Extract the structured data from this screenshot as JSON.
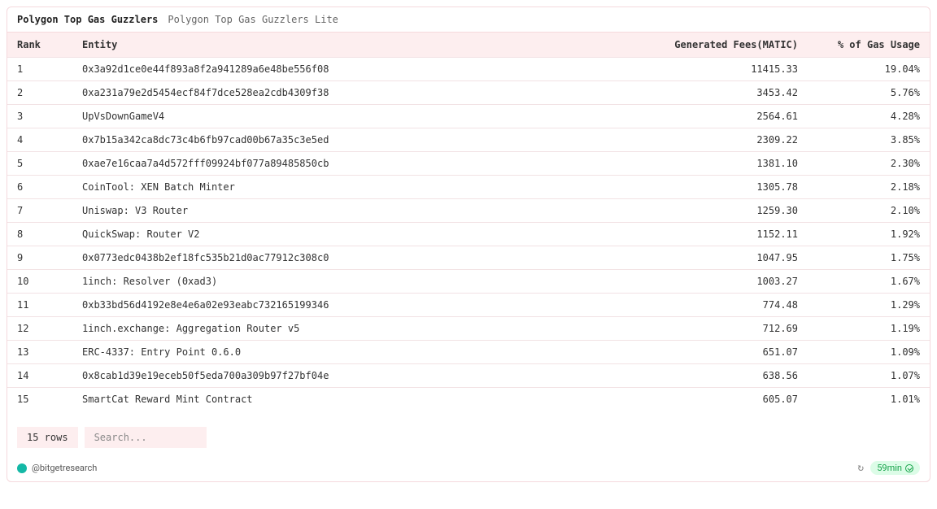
{
  "tabs": {
    "active": "Polygon Top Gas Guzzlers",
    "inactive": "Polygon Top Gas Guzzlers Lite"
  },
  "columns": {
    "rank": "Rank",
    "entity": "Entity",
    "fees": "Generated Fees(MATIC)",
    "pct": "% of Gas Usage"
  },
  "rows": [
    {
      "rank": "1",
      "entity": "0x3a92d1ce0e44f893a8f2a941289a6e48be556f08",
      "fees": "11415.33",
      "pct": "19.04%"
    },
    {
      "rank": "2",
      "entity": "0xa231a79e2d5454ecf84f7dce528ea2cdb4309f38",
      "fees": "3453.42",
      "pct": "5.76%"
    },
    {
      "rank": "3",
      "entity": "UpVsDownGameV4",
      "fees": "2564.61",
      "pct": "4.28%"
    },
    {
      "rank": "4",
      "entity": "0x7b15a342ca8dc73c4b6fb97cad00b67a35c3e5ed",
      "fees": "2309.22",
      "pct": "3.85%"
    },
    {
      "rank": "5",
      "entity": "0xae7e16caa7a4d572fff09924bf077a89485850cb",
      "fees": "1381.10",
      "pct": "2.30%"
    },
    {
      "rank": "6",
      "entity": "CoinTool: XEN Batch Minter",
      "fees": "1305.78",
      "pct": "2.18%"
    },
    {
      "rank": "7",
      "entity": "Uniswap: V3 Router",
      "fees": "1259.30",
      "pct": "2.10%"
    },
    {
      "rank": "8",
      "entity": "QuickSwap: Router V2",
      "fees": "1152.11",
      "pct": "1.92%"
    },
    {
      "rank": "9",
      "entity": "0x0773edc0438b2ef18fc535b21d0ac77912c308c0",
      "fees": "1047.95",
      "pct": "1.75%"
    },
    {
      "rank": "10",
      "entity": "1inch: Resolver (0xad3)",
      "fees": "1003.27",
      "pct": "1.67%"
    },
    {
      "rank": "11",
      "entity": "0xb33bd56d4192e8e4e6a02e93eabc732165199346",
      "fees": "774.48",
      "pct": "1.29%"
    },
    {
      "rank": "12",
      "entity": "1inch.exchange: Aggregation Router v5",
      "fees": "712.69",
      "pct": "1.19%"
    },
    {
      "rank": "13",
      "entity": "ERC-4337: Entry Point 0.6.0",
      "fees": "651.07",
      "pct": "1.09%"
    },
    {
      "rank": "14",
      "entity": "0x8cab1d39e19eceb50f5eda700a309b97f27bf04e",
      "fees": "638.56",
      "pct": "1.07%"
    },
    {
      "rank": "15",
      "entity": "SmartCat Reward Mint Contract",
      "fees": "605.07",
      "pct": "1.01%"
    }
  ],
  "footer": {
    "row_count": "15 rows",
    "search_placeholder": "Search..."
  },
  "attribution": {
    "handle": "@bitgetresearch"
  },
  "status": {
    "time": "59min"
  }
}
